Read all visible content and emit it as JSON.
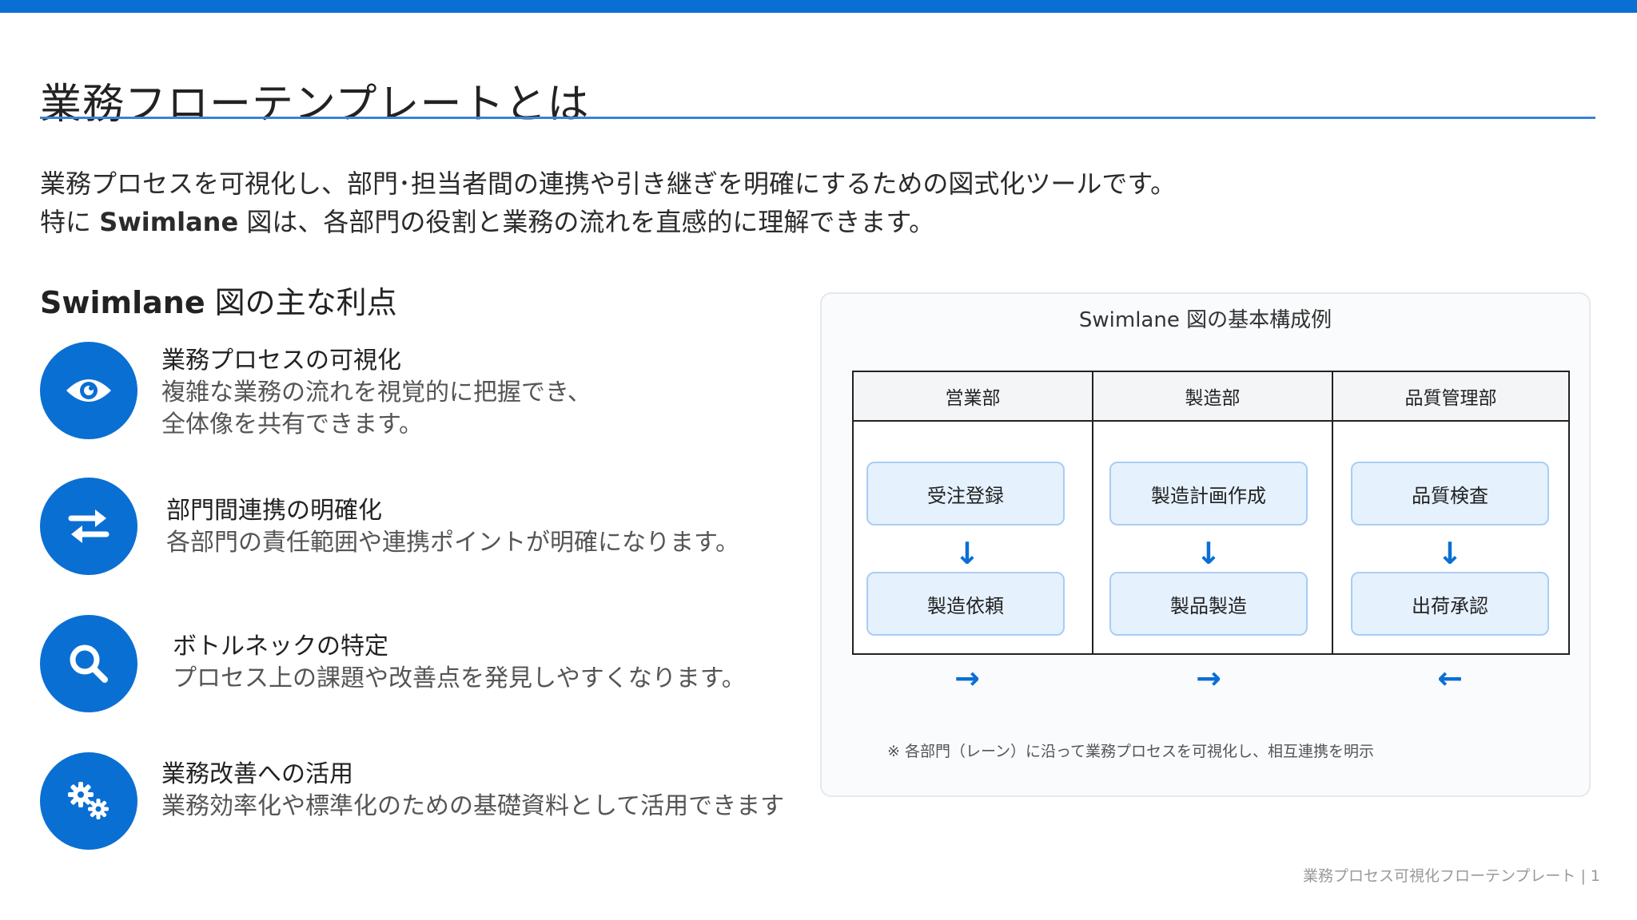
{
  "title": "業務フローテンプレートとは",
  "intro": {
    "line1": "業務プロセスを可視化し、部門･担当者間の連携や引き継ぎを明確にするための図式化ツールです。",
    "line2_prefix": "特に ",
    "line2_bold": "Swimlane",
    "line2_suffix": " 図は、各部門の役割と業務の流れを直感的に理解できます。"
  },
  "benefits_heading": {
    "bold": "Swimlane",
    "rest": " 図の主な利点"
  },
  "benefits": [
    {
      "icon": "eye-icon",
      "title": "業務プロセスの可視化",
      "desc1": "複雑な業務の流れを視覚的に把握でき、",
      "desc2": "全体像を共有できます。"
    },
    {
      "icon": "swap-arrows-icon",
      "title": "部門間連携の明確化",
      "desc1": "各部門の責任範囲や連携ポイントが明確になります。"
    },
    {
      "icon": "search-icon",
      "title": "ボトルネックの特定",
      "desc1": "プロセス上の課題や改善点を発見しやすくなります。"
    },
    {
      "icon": "gears-icon",
      "title": "業務改善への活用",
      "desc1": "業務効率化や標準化のための基礎資料として活用できます"
    }
  ],
  "diagram": {
    "title": "Swimlane 図の基本構成例",
    "lanes": [
      {
        "name": "営業部",
        "steps": [
          "受注登録",
          "製造依頼"
        ],
        "down_arrow": "↓",
        "flow_arrow": "→"
      },
      {
        "name": "製造部",
        "steps": [
          "製造計画作成",
          "製品製造"
        ],
        "down_arrow": "↓",
        "flow_arrow": "→"
      },
      {
        "name": "品質管理部",
        "steps": [
          "品質検査",
          "出荷承認"
        ],
        "down_arrow": "↓",
        "flow_arrow": "←"
      }
    ],
    "note": "※ 各部門（レーン）に沿って業務プロセスを可視化し、相互連携を明示"
  },
  "footer": {
    "text": "業務プロセス可視化フローテンプレート",
    "separator": "|",
    "page": "1"
  },
  "colors": {
    "accent": "#0a6fd3",
    "rule": "#3b82d9",
    "step_fill": "#e5f1fd",
    "step_border": "#a9cdf5"
  }
}
